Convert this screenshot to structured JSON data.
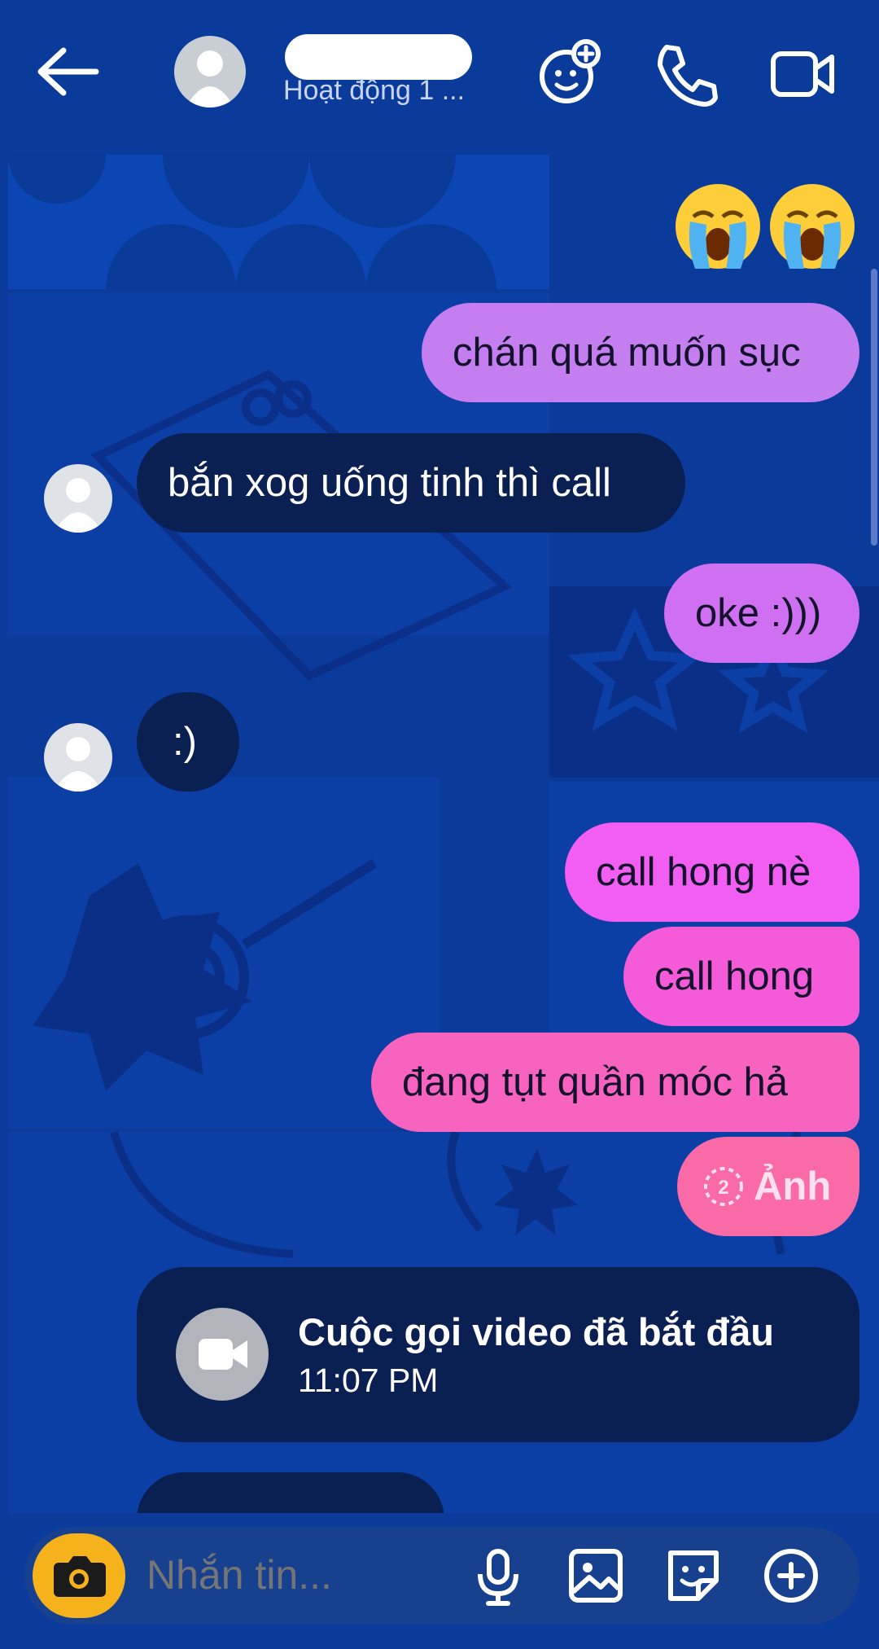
{
  "header": {
    "status_text": "Hoạt động 1 ...",
    "icons": [
      "back-arrow-icon",
      "avatar-icon",
      "game-icon",
      "phone-icon",
      "video-camera-icon"
    ]
  },
  "messages": [
    {
      "side": "out",
      "type": "emoji",
      "content": "😭😭"
    },
    {
      "side": "out",
      "text": "chán quá muốn sục",
      "color": "#c47ef0"
    },
    {
      "side": "in",
      "text": "bắn xog uống tinh thì call"
    },
    {
      "side": "out",
      "text": "oke :)))",
      "color": "#cf6ff2"
    },
    {
      "side": "in",
      "text": ":)"
    },
    {
      "side": "out",
      "text": "call hong nè",
      "color": "#f25df2"
    },
    {
      "side": "out",
      "text": "call hong",
      "color": "#f55ad8"
    },
    {
      "side": "out",
      "text": "đang tụt quần móc hả",
      "color": "#f863c0"
    },
    {
      "side": "out",
      "text": "Ảnh",
      "color": "#fa6aa6",
      "badge": "2"
    }
  ],
  "call_card": {
    "title": "Cuộc gọi video đã bắt đầu",
    "time": "11:07 PM"
  },
  "composer": {
    "placeholder": "Nhắn tin...",
    "accent": "#f6b21a"
  },
  "colors": {
    "background": "#0a3a9a",
    "incoming_bubble": "#0a1f52"
  }
}
